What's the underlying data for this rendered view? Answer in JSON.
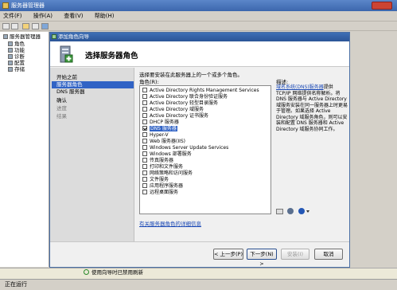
{
  "outer": {
    "title": "服务器管理器",
    "menu": [
      "文件(F)",
      "操作(A)",
      "查看(V)",
      "帮助(H)"
    ],
    "tree": [
      "服务器管理器",
      "角色",
      "功能",
      "诊断",
      "配置",
      "存储"
    ],
    "status": "正在运行"
  },
  "wizard": {
    "title": "添加角色向导",
    "heading": "选择服务器角色",
    "steps": [
      {
        "label": "开始之前",
        "state": "normal"
      },
      {
        "label": "服务器角色",
        "state": "selected"
      },
      {
        "label": "DNS 服务器",
        "state": "normal"
      },
      {
        "label": "确认",
        "state": "normal"
      },
      {
        "label": "进度",
        "state": "dim"
      },
      {
        "label": "结果",
        "state": "dim"
      }
    ],
    "instruction": "选择要安装在此服务器上的一个或多个角色。",
    "roles_label": "角色(R):",
    "roles": [
      {
        "label": "Active Directory Rights Management Services",
        "checked": false
      },
      {
        "label": "Active Directory 联合身份验证服务",
        "checked": false
      },
      {
        "label": "Active Directory 轻型目录服务",
        "checked": false
      },
      {
        "label": "Active Directory 域服务",
        "checked": false
      },
      {
        "label": "Active Directory 证书服务",
        "checked": false
      },
      {
        "label": "DHCP 服务器",
        "checked": false
      },
      {
        "label": "DNS 服务器",
        "checked": true,
        "highlighted": true
      },
      {
        "label": "Hyper-V",
        "checked": false
      },
      {
        "label": "Web 服务器(IIS)",
        "checked": false
      },
      {
        "label": "Windows Server Update Services",
        "checked": false
      },
      {
        "label": "Windows 部署服务",
        "checked": false
      },
      {
        "label": "传真服务器",
        "checked": false
      },
      {
        "label": "打印和文件服务",
        "checked": false
      },
      {
        "label": "网络策略和访问服务",
        "checked": false
      },
      {
        "label": "文件服务",
        "checked": false
      },
      {
        "label": "应用程序服务器",
        "checked": false
      },
      {
        "label": "远程桌面服务",
        "checked": false
      }
    ],
    "description_label": "描述:",
    "description_link": "域名系统(DNS)服务器",
    "description_text": "提供 TCP/IP 网络提供名称解析。将 DNS 服务器与 Active Directory 域服务安装在同一服务器上时更易于管理。如果选择 Active Directory 域服务角色，则可以安装和配置 DNS 服务器和 Active Directory 域服务协同工作。",
    "more_link": "有关服务器角色的详细信息",
    "buttons": {
      "back": "< 上一步(P)",
      "next": "下一步(N) >",
      "install": "安装(I)",
      "cancel": "取消"
    }
  },
  "refresh_text": "使用向导时已禁用刷新",
  "colors": {
    "selection": "#3163c5",
    "link": "#1a48b5",
    "title_bar": "#3c67ad"
  }
}
